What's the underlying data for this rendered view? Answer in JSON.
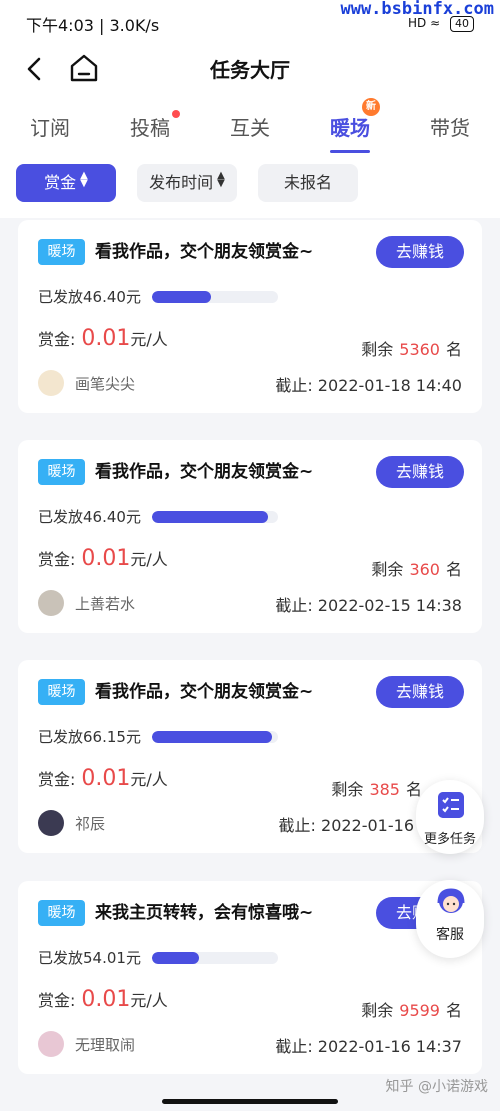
{
  "status_bar": {
    "time": "下午4:03 | 3.0K/s",
    "watermark": "www.bsbinfx.com",
    "signal": "HD",
    "battery": "40"
  },
  "header": {
    "title": "任务大厅"
  },
  "tabs": [
    {
      "label": "订阅"
    },
    {
      "label": "投稿"
    },
    {
      "label": "互关"
    },
    {
      "label": "暖场",
      "badge": "新"
    },
    {
      "label": "带货"
    }
  ],
  "filters": [
    {
      "label": "赏金"
    },
    {
      "label": "发布时间"
    },
    {
      "label": "未报名"
    }
  ],
  "card_common": {
    "tag": "暖场",
    "earn_button": "去赚钱",
    "reward_label": "赏金:",
    "reward_unit": "元/人",
    "remain_prefix": "剩余",
    "remain_suffix": "名"
  },
  "cards": [
    {
      "title": "看我作品，交个朋友领赏金~",
      "paid": "已发放46.40元",
      "progress": 0.47,
      "reward": "0.01",
      "remain": "5360",
      "user": "画笔尖尖",
      "deadline": "截止: 2022-01-18 14:40"
    },
    {
      "title": "看我作品，交个朋友领赏金~",
      "paid": "已发放46.40元",
      "progress": 0.92,
      "reward": "0.01",
      "remain": "360",
      "user": "上善若水",
      "deadline": "截止: 2022-02-15 14:38"
    },
    {
      "title": "看我作品，交个朋友领赏金~",
      "paid": "已发放66.15元",
      "progress": 0.95,
      "reward": "0.01",
      "remain": "385",
      "user": "祁辰",
      "deadline": "截止: 2022-01-16"
    },
    {
      "title": "来我主页转转，会有惊喜哦~",
      "paid": "已发放54.01元",
      "progress": 0.37,
      "reward": "0.01",
      "remain": "9599",
      "user": "无理取闹",
      "deadline": "截止: 2022-01-16 14:37"
    }
  ],
  "floating": {
    "more_tasks": "更多任务",
    "customer_service": "客服"
  },
  "footer_mark": "知乎 @小诺游戏"
}
